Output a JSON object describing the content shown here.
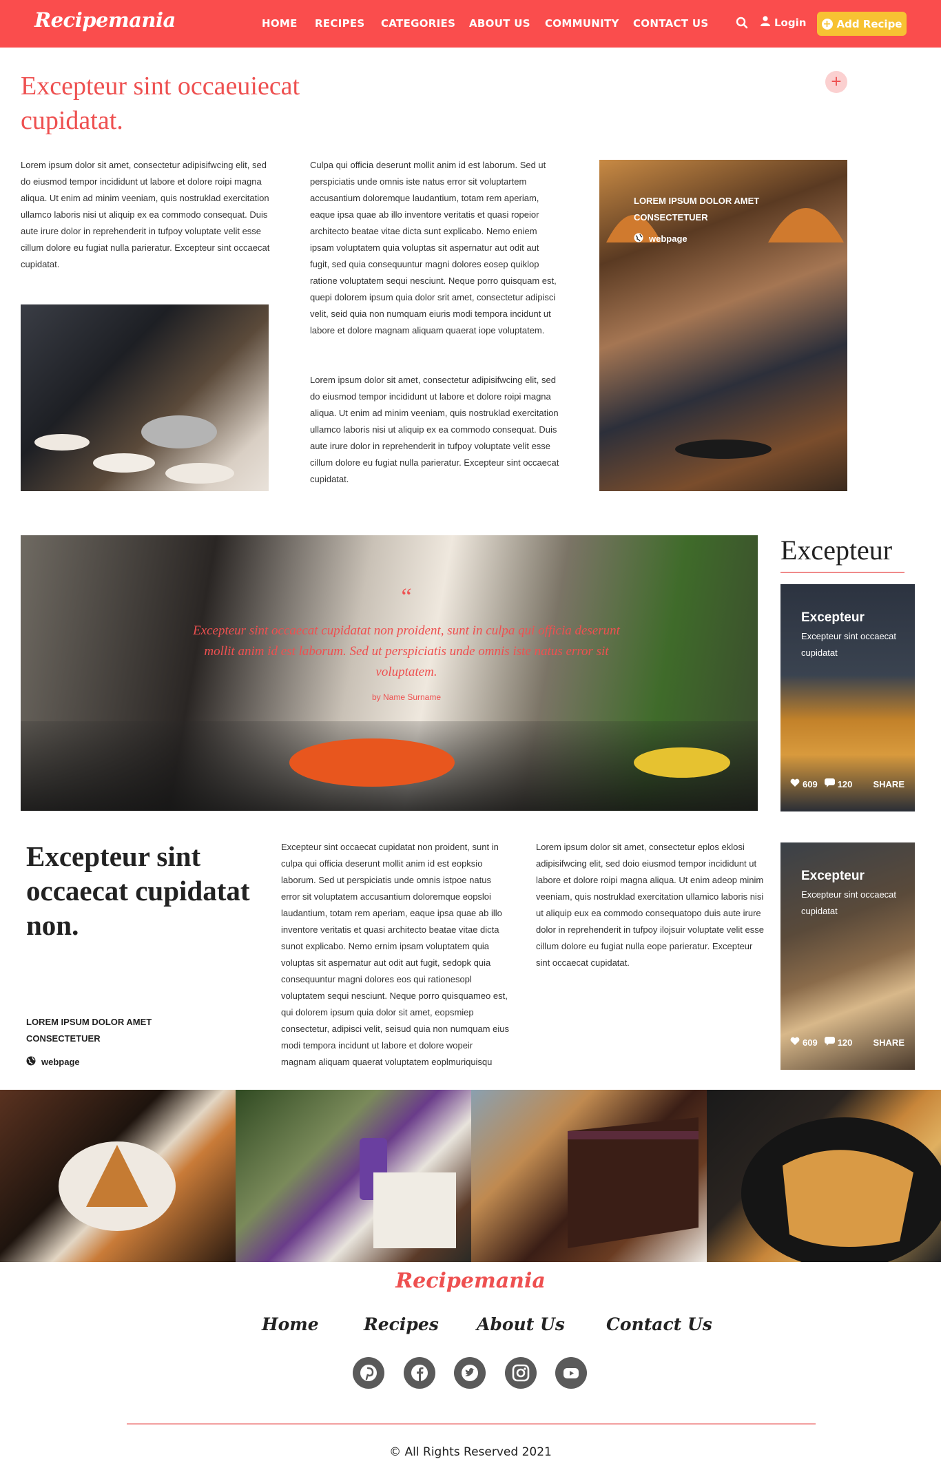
{
  "header": {
    "logo": "Recipemania",
    "nav": [
      "HOME",
      "RECIPES",
      "CATEGORIES",
      "ABOUT US",
      "COMMUNITY",
      "CONTACT US"
    ],
    "login": "Login",
    "add_recipe": "Add Recipe"
  },
  "intro": {
    "title": "Excepteur sint occaeuiecat cupidatat.",
    "para1": "Lorem ipsum dolor sit amet, consectetur adipisifwcing elit, sed do eiusmod tempor incididunt ut labore et dolore roipi magna aliqua. Ut enim ad minim veeniam, quis nostruklad exercitation ullamco laboris nisi ut aliquip ex ea commodo consequat. Duis aute irure dolor in reprehenderit in tufpoy voluptate velit esse cillum dolore eu fugiat nulla parieratur. Excepteur sint occaecat cupidatat.",
    "para2": "Culpa qui officia deserunt mollit anim id est laborum. Sed ut perspiciatis unde omnis iste natus error sit voluptartem accusantium doloremque laudantium, totam rem aperiam, eaque ipsa quae ab illo inventore veritatis et quasi ropeior architecto beatae vitae dicta sunt explicabo. Nemo eniem ipsam voluptatem quia voluptas sit aspernatur aut odit aut fugit, sed quia consequuntur magni dolores eosep quiklop ratione voluptatem sequi nesciunt. Neque porro quisquam est, quepi dolorem ipsum quia dolor srit amet, consectetur adipisci velit, seid quia non numquam eiuris modi tempora incidunt ut labore et dolore magnam aliquam quaerat iope voluptatem.",
    "para3": "Lorem ipsum dolor sit amet, consectetur adipisifwcing elit, sed do eiusmod tempor incididunt ut labore et dolore roipi magna aliqua. Ut enim ad minim veeniam, quis nostruklad exercitation ullamco laboris nisi ut aliquip ex ea commodo consequat. Duis aute irure dolor in reprehenderit in tufpoy voluptate velit esse cillum dolore eu fugiat nulla parieratur. Excepteur sint occaecat cupidatat.",
    "overlay_title": "LOREM IPSUM DOLOR AMET CONSECTETUER",
    "overlay_link": "webpage"
  },
  "quote": {
    "mark": "“",
    "text": "Excepteur sint occaecat cupidatat non proident, sunt in culpa qui officia deserunt mollit anim id est laborum. Sed ut perspiciatis unde omnis iste natus error sit voluptatem.",
    "by": "by Name Surname"
  },
  "sidebar": {
    "title": "Excepteur",
    "cards": [
      {
        "title": "Excepteur",
        "subtitle": "Excepteur sint occaecat cupidatat",
        "likes": "609",
        "comments": "120",
        "share": "SHARE"
      },
      {
        "title": "Excepteur",
        "subtitle": "Excepteur sint occaecat cupidatat",
        "likes": "609",
        "comments": "120",
        "share": "SHARE"
      }
    ]
  },
  "lower": {
    "title": "Excepteur sint occaecat cupidatat non.",
    "meta_title": "LOREM IPSUM DOLOR AMET CONSECTETUER",
    "meta_link": "webpage",
    "para1": "Excepteur sint occaecat cupidatat non proident, sunt in culpa qui officia deserunt mollit anim id est eopksio laborum. Sed ut perspiciatis unde omnis istpoe natus error sit voluptatem accusantium doloremque eopsloi laudantium, totam rem aperiam, eaque ipsa quae ab illo inventore veritatis et quasi architecto beatae vitae dicta sunot explicabo. Nemo ernim ipsam voluptatem quia voluptas sit aspernatur aut odit aut fugit, sedopk quia consequuntur magni dolores eos qui rationesopl voluptatem sequi nesciunt. Neque porro quisquameo est, qui dolorem ipsum quia dolor sit amet, eopsmiep consectetur, adipisci velit, seisud quia non numquam eius modi tempora incidunt ut labore et dolore wopeir magnam aliquam quaerat voluptatem eoplmuriquisqu",
    "para2": "Lorem ipsum dolor sit amet, consectetur eplos eklosi adipisifwcing elit, sed doio eiusmod tempor incididunt ut labore et dolore roipi magna aliqua. Ut enim adeop minim veeniam, quis nostruklad exercitation ullamico laboris nisi ut aliquip eux ea commodo consequatopo duis aute irure dolor in reprehenderit in tufpoy ilojsuir voluptate velit esse cillum dolore eu fugiat nulla eope parieratur. Excepteur sint occaecat cupidatat."
  },
  "footer": {
    "logo": "Recipemania",
    "nav": [
      "Home",
      "Recipes",
      "About Us",
      "Contact Us"
    ],
    "social": [
      "pinterest-icon",
      "facebook-icon",
      "twitter-icon",
      "instagram-icon",
      "youtube-icon"
    ],
    "copyright": "© All Rights Reserved 2021"
  },
  "colors": {
    "brand": "#fa4d4d",
    "accent": "#f7c233",
    "heading": "#ee5050"
  }
}
